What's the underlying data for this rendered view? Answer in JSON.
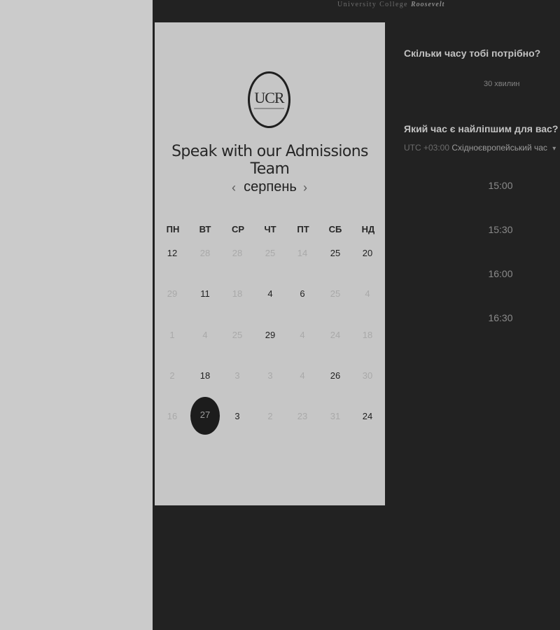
{
  "brand": {
    "part1": "University College",
    "part2": "Roosevelt"
  },
  "card": {
    "logo_text": "UCR",
    "title": "Speak with our Admissions Team",
    "month": "серпень",
    "prev_icon": "‹",
    "next_icon": "›",
    "weekdays": [
      "ПН",
      "ВТ",
      "СР",
      "ЧТ",
      "ПТ",
      "СБ",
      "НД"
    ],
    "weeks": [
      [
        {
          "d": "12",
          "active": true
        },
        {
          "d": "28",
          "active": false
        },
        {
          "d": "28",
          "active": false
        },
        {
          "d": "25",
          "active": false
        },
        {
          "d": "14",
          "active": false
        },
        {
          "d": "25",
          "active": true
        },
        {
          "d": "20",
          "active": true
        }
      ],
      [
        {
          "d": "29",
          "active": false
        },
        {
          "d": "11",
          "active": true
        },
        {
          "d": "18",
          "active": false
        },
        {
          "d": "4",
          "active": true
        },
        {
          "d": "6",
          "active": true
        },
        {
          "d": "25",
          "active": false
        },
        {
          "d": "4",
          "active": false
        }
      ],
      [
        {
          "d": "1",
          "active": false
        },
        {
          "d": "4",
          "active": false
        },
        {
          "d": "25",
          "active": false
        },
        {
          "d": "29",
          "active": true
        },
        {
          "d": "4",
          "active": false
        },
        {
          "d": "24",
          "active": false
        },
        {
          "d": "18",
          "active": false
        }
      ],
      [
        {
          "d": "2",
          "active": false
        },
        {
          "d": "18",
          "active": true
        },
        {
          "d": "3",
          "active": false
        },
        {
          "d": "3",
          "active": false
        },
        {
          "d": "4",
          "active": false
        },
        {
          "d": "26",
          "active": true
        },
        {
          "d": "30",
          "active": false
        }
      ],
      [
        {
          "d": "16",
          "active": false
        },
        {
          "d": "27",
          "active": true,
          "selected": true
        },
        {
          "d": "3",
          "active": true
        },
        {
          "d": "2",
          "active": false
        },
        {
          "d": "23",
          "active": false
        },
        {
          "d": "31",
          "active": false
        },
        {
          "d": "24",
          "active": true
        }
      ]
    ]
  },
  "booking": {
    "duration_question": "Скільки часу тобі потрібно?",
    "duration_value": "30 хвилин",
    "time_question": "Який час є найліпшим для вас?",
    "timezone_offset": "UTC +03:00",
    "timezone_name": "Східноєвропейський час",
    "timezone_caret": "▾",
    "slots": [
      "15:00",
      "15:30",
      "16:00",
      "16:30"
    ]
  },
  "colors": {
    "dark_bg": "#222222",
    "card_bg": "#c6c6c6",
    "left_bg": "#cbcbcb",
    "selected_day_bg": "#1c1c1c"
  }
}
